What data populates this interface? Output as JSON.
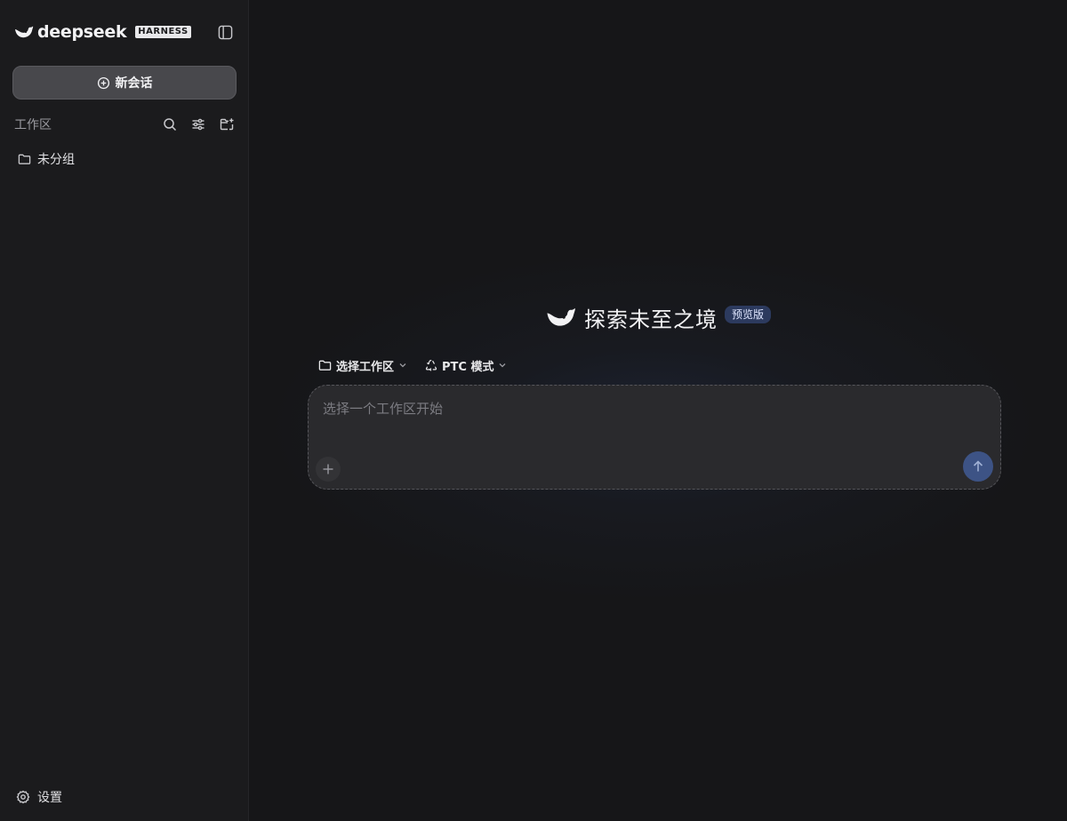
{
  "sidebar": {
    "logo_text": "deepseek",
    "logo_badge": "HARNESS",
    "new_chat_label": "新会话",
    "workspace_label": "工作区",
    "groups": [
      {
        "label": "未分组"
      }
    ],
    "settings_label": "设置"
  },
  "main": {
    "hero_title": "探索未至之境",
    "hero_badge": "预览版",
    "workspace_select_label": "选择工作区",
    "mode_label": "PTC 模式",
    "input_placeholder": "选择一个工作区开始",
    "input_value": ""
  },
  "colors": {
    "accent": "#3d5385",
    "badge_bg": "#2c3a5e",
    "sidebar_bg": "#1b1b1d",
    "main_bg": "#161618"
  }
}
